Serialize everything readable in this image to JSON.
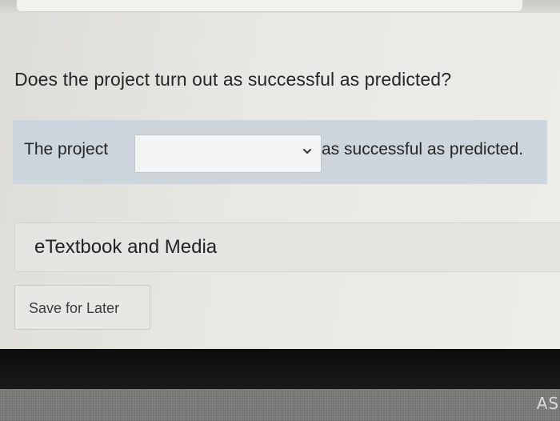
{
  "question": {
    "text": "Does the project turn out as successful as predicted?"
  },
  "answer": {
    "lead_text": "The project",
    "select_value": "",
    "select_icon": "chevron-down-icon",
    "tail_text": "as successful as predicted."
  },
  "resources": {
    "etextbook_label": "eTextbook and Media"
  },
  "actions": {
    "save_label": "Save for Later"
  },
  "device": {
    "brand_text": "ASI"
  },
  "colors": {
    "answer_row_bg": "#cdd6dc",
    "page_bg": "#e8e8e4",
    "bezel": "#111111"
  }
}
